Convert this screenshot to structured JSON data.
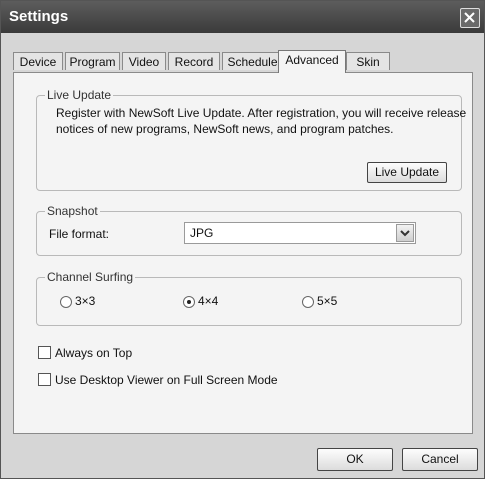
{
  "window": {
    "title": "Settings"
  },
  "tabs": [
    "Device",
    "Program",
    "Video",
    "Record",
    "Schedule",
    "Advanced",
    "Skin"
  ],
  "active_tab": "Advanced",
  "live_update": {
    "legend": "Live Update",
    "line1": "Register with NewSoft Live Update. After registration, you will receive release",
    "line2": "notices of new programs, NewSoft news, and program patches.",
    "button": "Live Update"
  },
  "snapshot": {
    "legend": "Snapshot",
    "label": "File format:",
    "value": "JPG"
  },
  "channel_surfing": {
    "legend": "Channel Surfing",
    "options": [
      "3×3",
      "4×4",
      "5×5"
    ],
    "selected": "4×4"
  },
  "checkboxes": [
    {
      "label": "Always on Top",
      "checked": false
    },
    {
      "label": "Use Desktop Viewer on Full Screen Mode",
      "checked": false
    }
  ],
  "footer": {
    "ok": "OK",
    "cancel": "Cancel"
  }
}
